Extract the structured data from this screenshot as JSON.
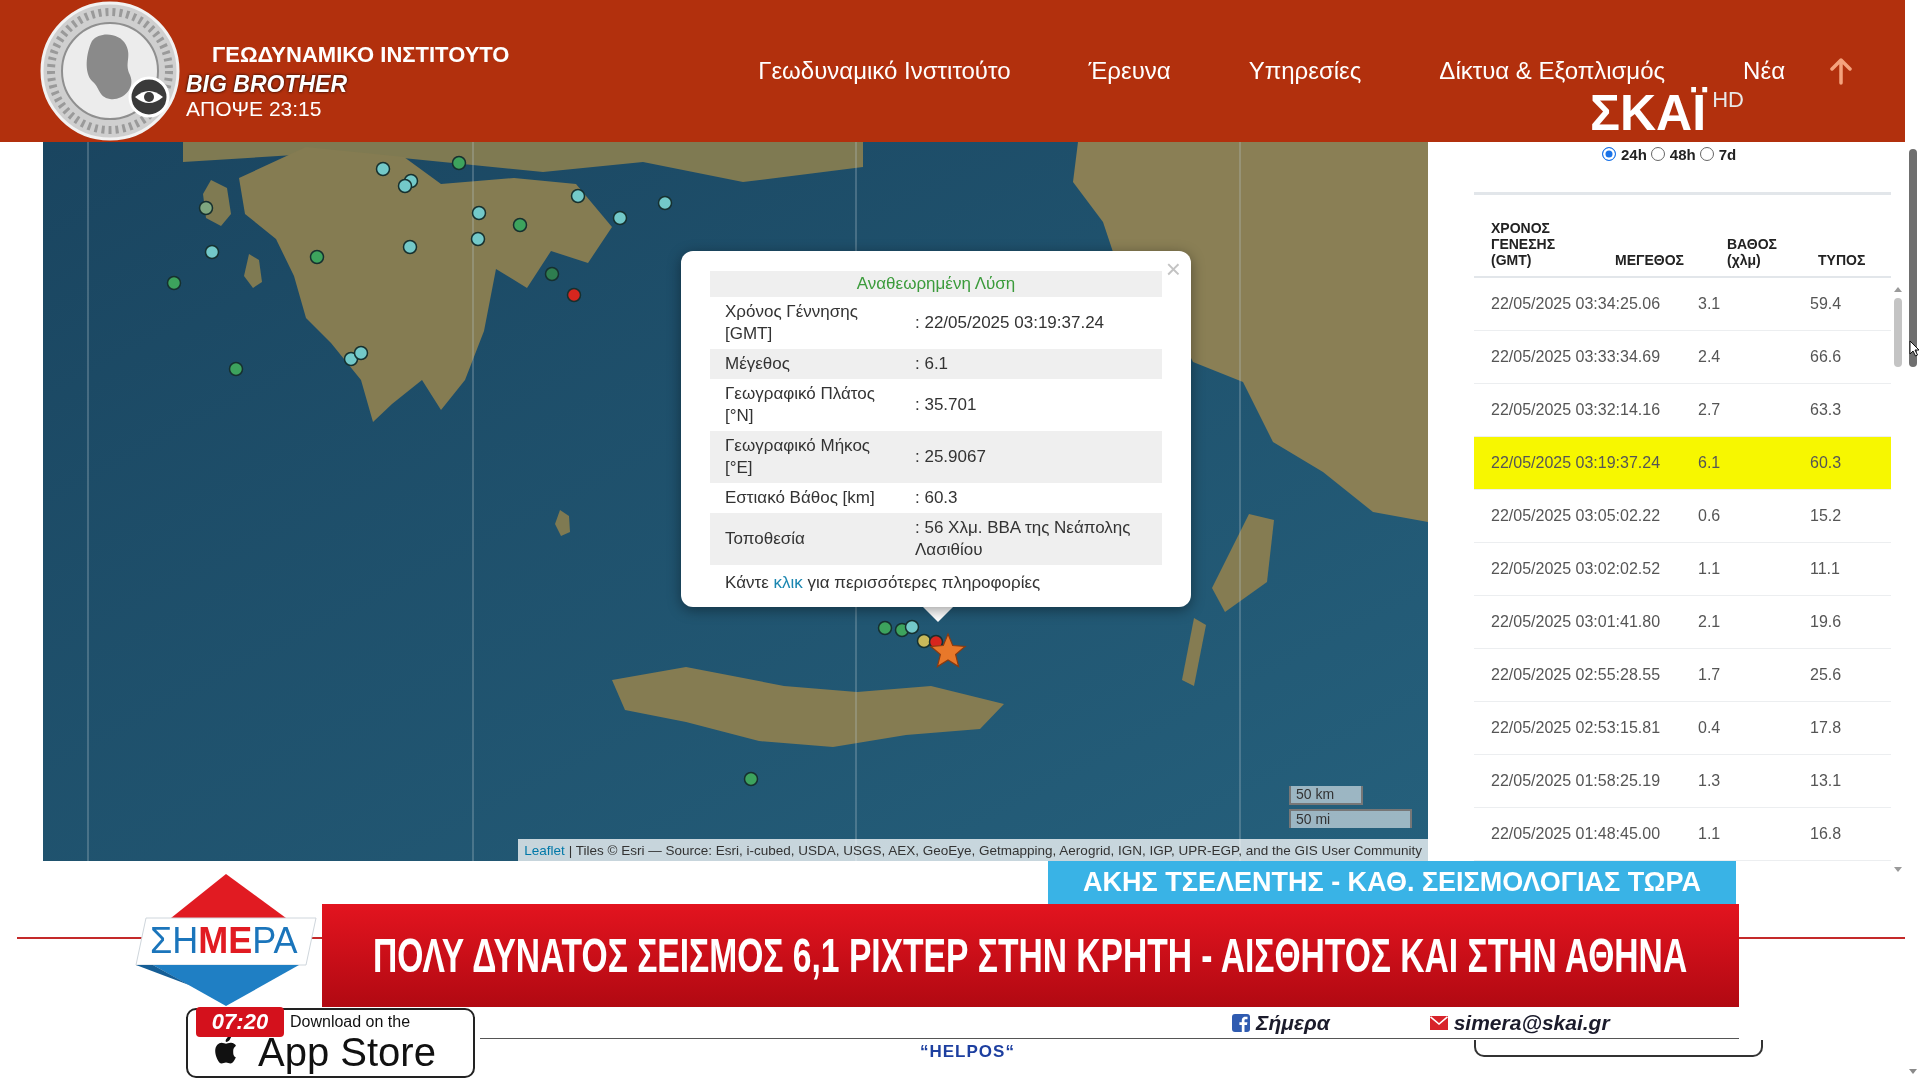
{
  "header": {
    "site_title": "ΓΕΩΔΥΝΑΜΙΚΟ ΙΝΣΤΙΤΟΥΤΟ",
    "nav": [
      {
        "label": "Γεωδυναμικό Ινστιτούτο"
      },
      {
        "label": "Έρευνα"
      },
      {
        "label": "Υπηρεσίες"
      },
      {
        "label": "Δίκτυα & Εξοπλισμός"
      },
      {
        "label": "Νέα"
      }
    ]
  },
  "tv_overlay": {
    "promo": {
      "show": "BIG BROTHER",
      "time": "ΑΠΟΨΕ 23:15"
    },
    "channel": {
      "name": "ΣΚΑΪ",
      "suffix": "HD"
    },
    "strap": "ΑΚΗΣ ΤΣΕΛΕΝΤΗΣ - ΚΑΘ. ΣΕΙΣΜΟΛΟΓΙΑΣ ΤΩΡΑ",
    "headline": "ΠΟΛΥ ΔΥΝΑΤΟΣ ΣΕΙΣΜΟΣ 6,1 ΡΙΧΤΕΡ ΣΤΗΝ ΚΡΗΤΗ - ΑΙΣΘΗΤΟΣ ΚΑΙ ΣΤΗΝ ΑΘΗΝΑ",
    "show_logo": "ΣΗ**ΜΕ**ΡΑ",
    "clock": "07:20",
    "social": [
      {
        "kind": "facebook",
        "text": "Σήμερα"
      },
      {
        "kind": "email",
        "text": "simera@skai.gr"
      }
    ]
  },
  "map": {
    "popup": {
      "close": "×",
      "title": "Αναθεωρημένη Λύση",
      "rows": [
        {
          "label": "Χρόνος Γέννησης [GMT]",
          "value": ": 22/05/2025 03:19:37.24"
        },
        {
          "label": "Μέγεθος",
          "value": ": 6.1"
        },
        {
          "label": "Γεωγραφικό Πλάτος [°N]",
          "value": ": 35.701"
        },
        {
          "label": "Γεωγραφικό Μήκος [°E]",
          "value": ": 25.9067"
        },
        {
          "label": "Εστιακό Βάθος [km]",
          "value": ": 60.3"
        },
        {
          "label": "Τοποθεσία",
          "value": ": 56 Χλμ. ΒΒΑ της Νεάπολης Λασιθίου"
        }
      ],
      "footer": {
        "before": "Κάντε",
        "link": "κλικ",
        "after": "για περισσότερες πληροφορίες"
      }
    },
    "scale": [
      "50 km",
      "50 mi"
    ],
    "attribution": {
      "link": "Leaflet",
      "text": "| Tiles © Esri — Source: Esri, i-cubed, USDA, USGS, AEX, GeoEye, Getmapping, Aerogrid, IGN, IGP, UPR-EGP, and the GIS User Community"
    }
  },
  "events_panel": {
    "ranges": [
      {
        "label": "24h",
        "selected": true
      },
      {
        "label": "48h",
        "selected": false
      },
      {
        "label": "7d",
        "selected": false
      }
    ],
    "table": {
      "columns": [
        "ΧΡΟΝΟΣ ΓΕΝΕΣΗΣ (GMT)",
        "ΜΕΓΕΘΟΣ",
        "ΒΑΘΟΣ (χλμ)",
        "ΤΥΠΟΣ"
      ],
      "rows": [
        {
          "time": "22/05/2025 03:34:25.06",
          "magnitude": "3.1",
          "depth": "59.4",
          "selected": false
        },
        {
          "time": "22/05/2025 03:33:34.69",
          "magnitude": "2.4",
          "depth": "66.6",
          "selected": false
        },
        {
          "time": "22/05/2025 03:32:14.16",
          "magnitude": "2.7",
          "depth": "63.3",
          "selected": false
        },
        {
          "time": "22/05/2025 03:19:37.24",
          "magnitude": "6.1",
          "depth": "60.3",
          "selected": true
        },
        {
          "time": "22/05/2025 03:05:02.22",
          "magnitude": "0.6",
          "depth": "15.2",
          "selected": false
        },
        {
          "time": "22/05/2025 03:02:02.52",
          "magnitude": "1.1",
          "depth": "11.1",
          "selected": false
        },
        {
          "time": "22/05/2025 03:01:41.80",
          "magnitude": "2.1",
          "depth": "19.6",
          "selected": false
        },
        {
          "time": "22/05/2025 02:55:28.55",
          "magnitude": "1.7",
          "depth": "25.6",
          "selected": false
        },
        {
          "time": "22/05/2025 02:53:15.81",
          "magnitude": "0.4",
          "depth": "17.8",
          "selected": false
        },
        {
          "time": "22/05/2025 01:58:25.19",
          "magnitude": "1.3",
          "depth": "13.1",
          "selected": false
        },
        {
          "time": "22/05/2025 01:48:45.00",
          "magnitude": "1.1",
          "depth": "16.8",
          "selected": false
        }
      ]
    }
  },
  "footer": {
    "app_badge": {
      "caption": "Download on the",
      "title": "App Store"
    },
    "helpos": "“HELPOS“"
  }
}
